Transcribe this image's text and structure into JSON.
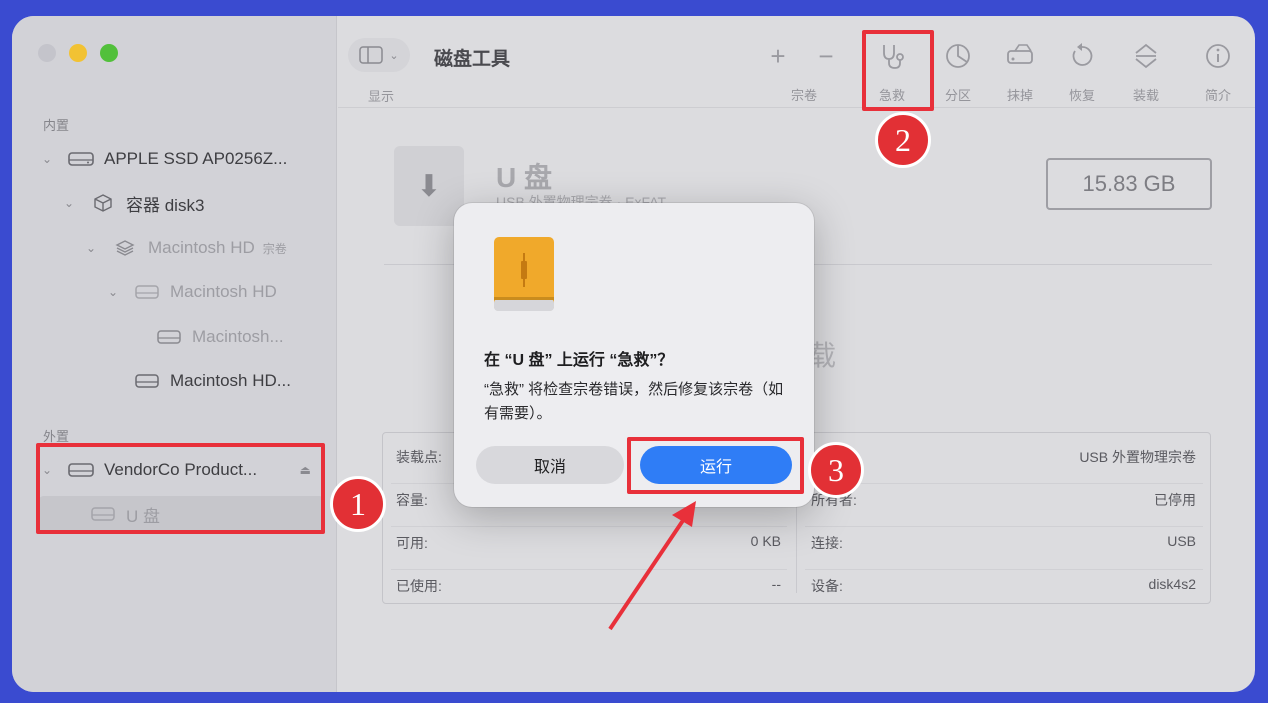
{
  "app": {
    "title": "磁盘工具"
  },
  "toolbar": {
    "view_label": "显示",
    "volume_label": "宗卷",
    "firstaid_label": "急救",
    "partition_label": "分区",
    "erase_label": "抹掉",
    "restore_label": "恢复",
    "mount_label": "装载",
    "info_label": "简介"
  },
  "sidebar": {
    "internal_label": "内置",
    "external_label": "外置",
    "items": [
      {
        "label": "APPLE SSD AP0256Z..."
      },
      {
        "label": "容器 disk3"
      },
      {
        "label": "Macintosh HD",
        "sub": "宗卷"
      },
      {
        "label": "Macintosh HD"
      },
      {
        "label": "Macintosh..."
      },
      {
        "label": "Macintosh HD..."
      },
      {
        "label": "VendorCo Product..."
      },
      {
        "label": "U 盘"
      }
    ]
  },
  "detail": {
    "name": "U 盘",
    "description": "USB 外置物理宗卷 · ExFAT",
    "size": "15.83 GB",
    "unmounted_text": "载",
    "rows_left": [
      {
        "key": "装载点:",
        "value": ""
      },
      {
        "key": "容量:",
        "value": ""
      },
      {
        "key": "可用:",
        "value": "0 KB"
      },
      {
        "key": "已使用:",
        "value": "--"
      }
    ],
    "rows_right": [
      {
        "key": "",
        "value": "USB 外置物理宗卷"
      },
      {
        "key": "所有者:",
        "value": "已停用"
      },
      {
        "key": "连接:",
        "value": "USB"
      },
      {
        "key": "设备:",
        "value": "disk4s2"
      }
    ]
  },
  "dialog": {
    "title": "在 “U 盘” 上运行 “急救”？",
    "message": "“急救” 将检查宗卷错误，然后修复该宗卷（如有需要）。",
    "cancel_label": "取消",
    "run_label": "运行"
  },
  "annotations": {
    "step1": "1",
    "step2": "2",
    "step3": "3",
    "color": "#e8303a"
  }
}
